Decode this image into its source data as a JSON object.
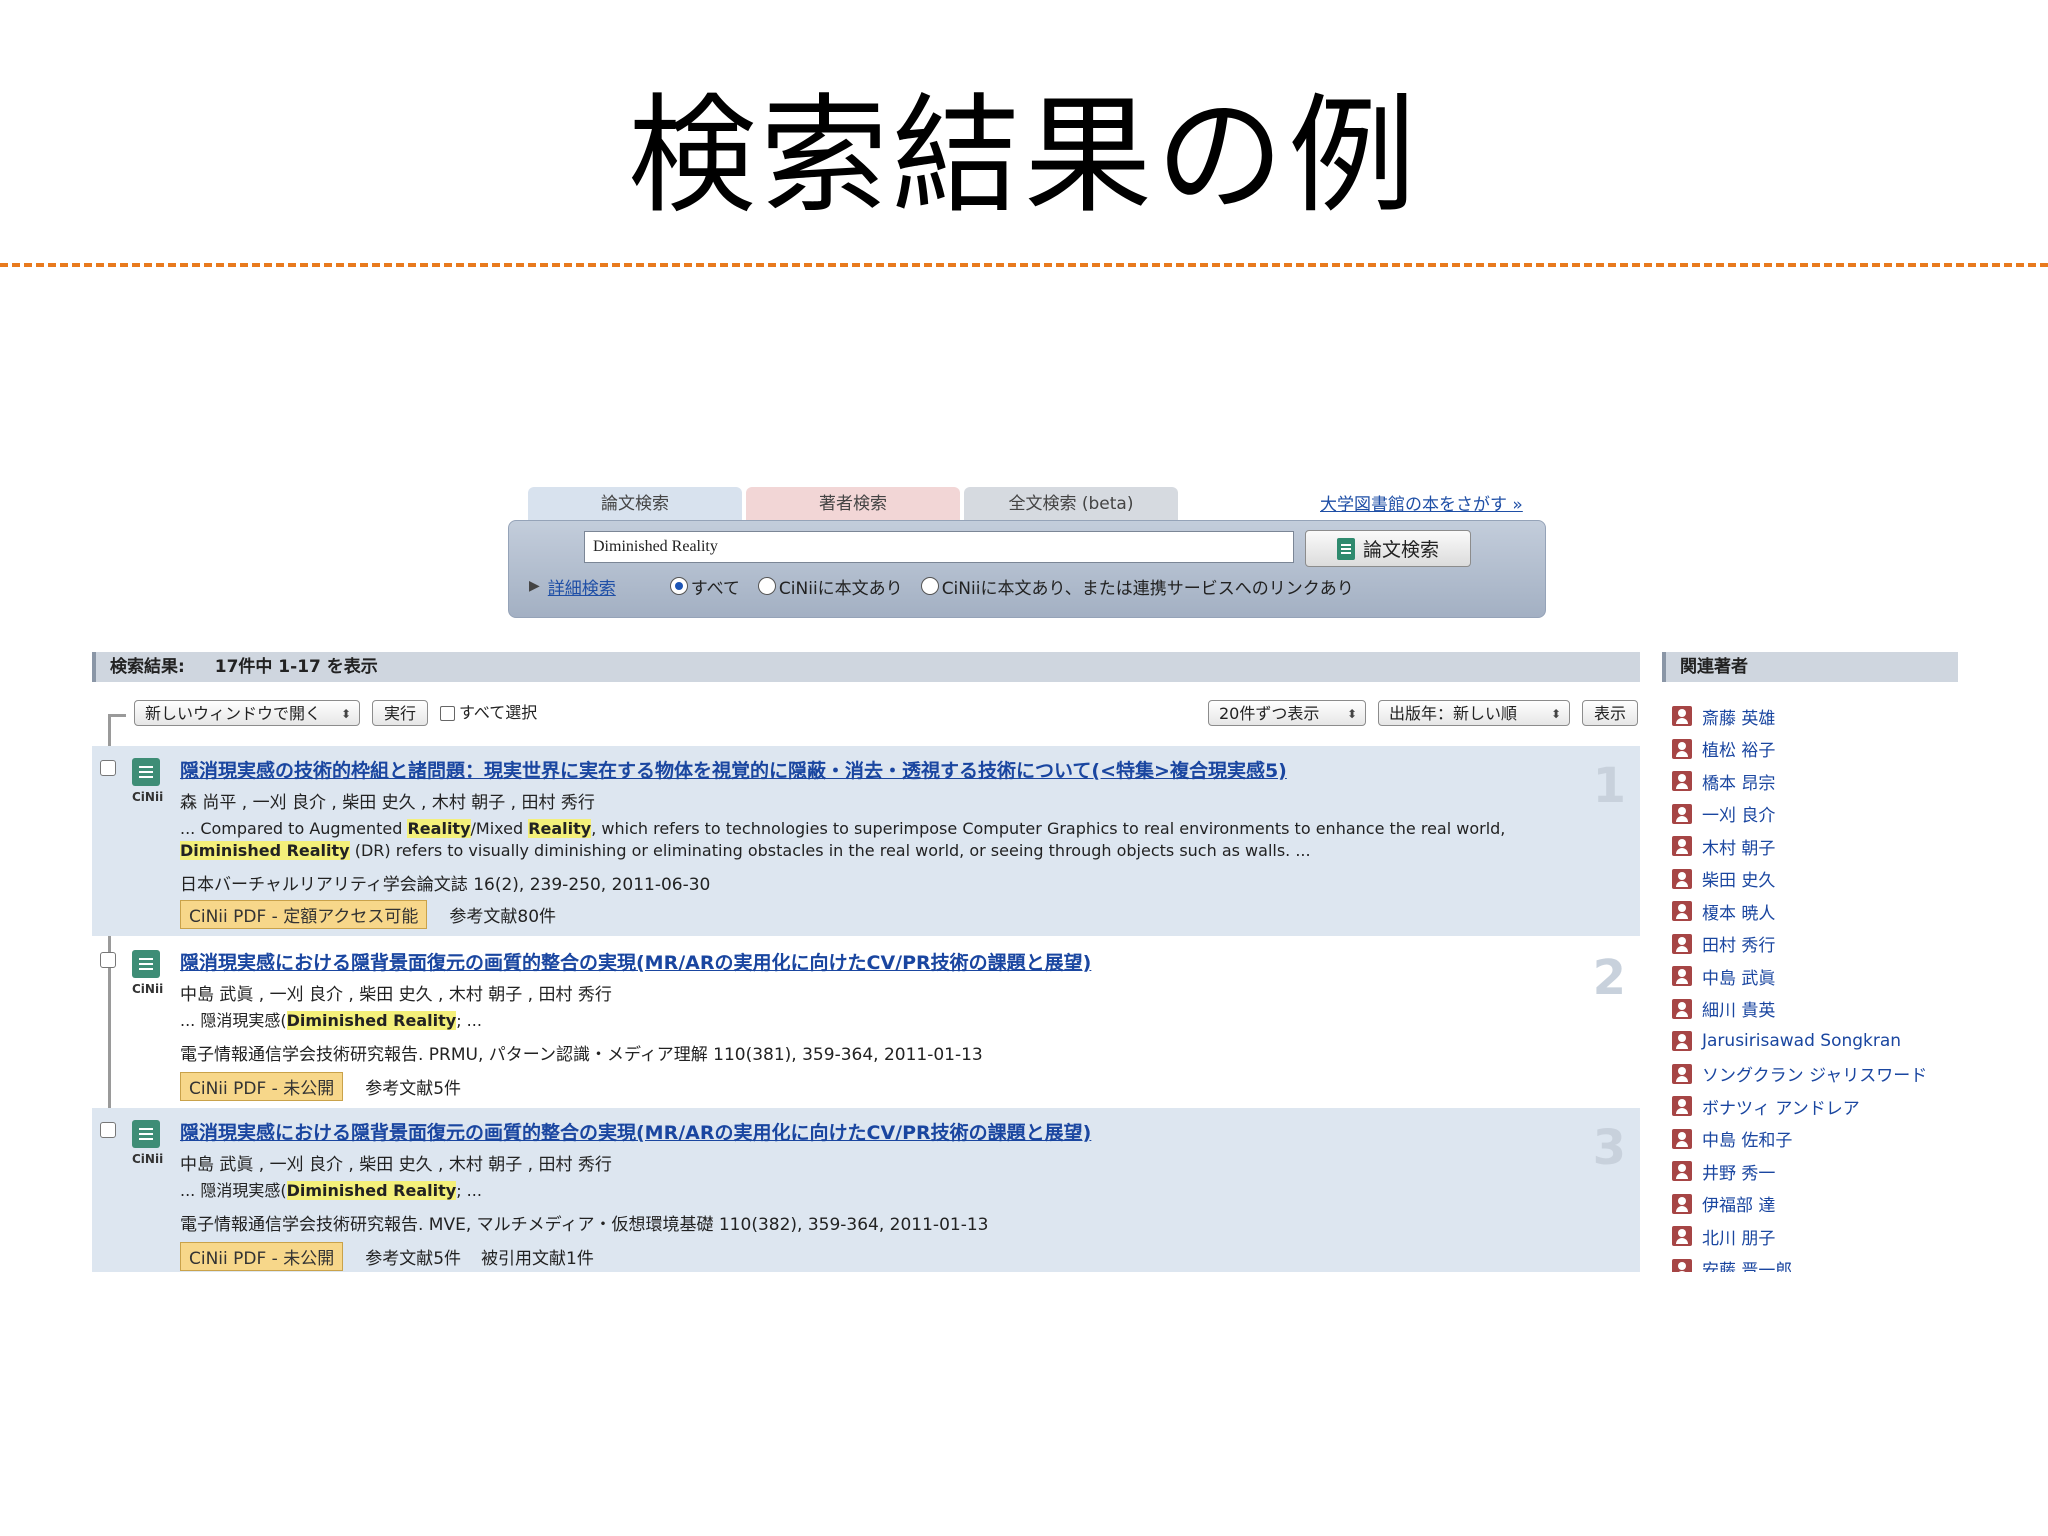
{
  "slide": {
    "title": "検索結果の例"
  },
  "search": {
    "tabs": [
      "論文検索",
      "著者検索",
      "全文検索 (beta)"
    ],
    "library_link": "大学図書館の本をさがす »",
    "query": "Diminished Reality",
    "submit_label": "論文検索",
    "advanced_link": "詳細検索",
    "options": [
      "すべて",
      "CiNiiに本文あり",
      "CiNiiに本文あり、または連携サービスへのリンクあり"
    ],
    "selected_option": "すべて"
  },
  "results": {
    "header_label": "検索結果:",
    "count_text": "17件中 1-17 を表示",
    "open_select": "新しいウィンドウで開く",
    "run_button": "実行",
    "select_all": "すべて選択",
    "per_page_select": "20件ずつ表示",
    "sort_select": "出版年：新しい順",
    "display_button": "表示",
    "items": [
      {
        "num": "1",
        "title": "隠消現実感の技術的枠組と諸問題：現実世界に実在する物体を視覚的に隠蔽・消去・透視する技術について(<特集>複合現実感5)",
        "authors": "森 尚平 , 一刈 良介 , 柴田 史久 , 木村 朝子 , 田村 秀行",
        "snippet": {
          "p1": "... Compared to Augmented ",
          "h1": "Reality",
          "p2": "/Mixed ",
          "h2": "Reality",
          "p3": ", which refers to technologies to superimpose Computer Graphics to real environments to enhance the real world, ",
          "h3": "Diminished Reality",
          "p4": " (DR) refers to visually diminishing or eliminating obstacles in the real world, or seeing through objects such as walls. ..."
        },
        "source": "日本バーチャルリアリティ学会論文誌 16(2), 239-250, 2011-06-30",
        "pdf": "CiNii PDF - 定額アクセス可能",
        "refs": "参考文献80件",
        "cited": ""
      },
      {
        "num": "2",
        "title": "隠消現実感における隠背景面復元の画質的整合の実現(MR/ARの実用化に向けたCV/PR技術の課題と展望)",
        "authors": "中島 武眞 , 一刈 良介 , 柴田 史久 , 木村 朝子 , 田村 秀行",
        "snippet": {
          "p1": "... 隠消現実感(",
          "h1": "Diminished Reality",
          "p2": "; ..."
        },
        "source": "電子情報通信学会技術研究報告. PRMU, パターン認識・メディア理解 110(381), 359-364, 2011-01-13",
        "pdf": "CiNii PDF - 未公開",
        "refs": "参考文献5件",
        "cited": ""
      },
      {
        "num": "3",
        "title": "隠消現実感における隠背景面復元の画質的整合の実現(MR/ARの実用化に向けたCV/PR技術の課題と展望)",
        "authors": "中島 武眞 , 一刈 良介 , 柴田 史久 , 木村 朝子 , 田村 秀行",
        "snippet": {
          "p1": "... 隠消現実感(",
          "h1": "Diminished Reality",
          "p2": "; ..."
        },
        "source": "電子情報通信学会技術研究報告. MVE, マルチメディア・仮想環境基礎 110(382), 359-364, 2011-01-13",
        "pdf": "CiNii PDF - 未公開",
        "refs": "参考文献5件",
        "cited": "被引用文献1件"
      }
    ]
  },
  "related": {
    "header": "関連著者",
    "authors": [
      "斎藤 英雄",
      "植松 裕子",
      "橋本 昂宗",
      "一刈 良介",
      "木村 朝子",
      "柴田 史久",
      "榎本 暁人",
      "田村 秀行",
      "中島 武眞",
      "細川 貴英",
      "Jarusirisawad Songkran",
      "ソングクラン ジャリスワード",
      "ボナツィ アンドレア",
      "中島 佐和子",
      "井野 秀一",
      "伊福部 達",
      "北川 朋子",
      "安藤 晋一郎"
    ]
  },
  "colors": {
    "divider": "#e87a1e",
    "link": "#1a46a0",
    "highlight": "#f4f07a",
    "pdf_badge": "#f7d78a"
  },
  "icons": [
    "document-icon",
    "person-icon",
    "arrow-right-icon"
  ]
}
